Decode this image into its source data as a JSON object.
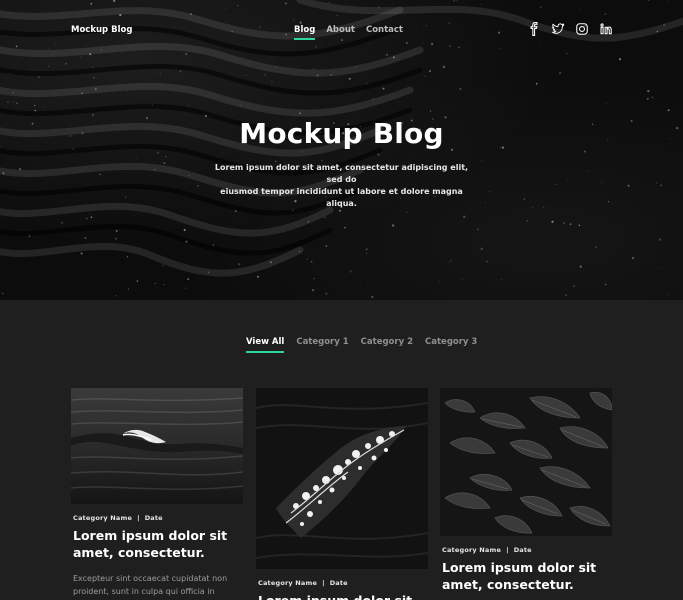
{
  "nav": {
    "brand": "Mockup Blog",
    "links": [
      "Blog",
      "About",
      "Contact"
    ],
    "active_link": "Blog",
    "socials": [
      "facebook-icon",
      "twitter-icon",
      "instagram-icon",
      "linkedin-icon"
    ]
  },
  "hero": {
    "title": "Mockup Blog",
    "subtitle_line1": "Lorem ipsum dolor sit amet, consectetur adipiscing elit, sed do",
    "subtitle_line2": "eiusmod tempor incididunt ut labore et dolore magna aliqua."
  },
  "filters": {
    "tabs": [
      "View All",
      "Category 1",
      "Category 2",
      "Category 3"
    ],
    "active": "View All"
  },
  "posts": [
    {
      "category": "Category Name",
      "date": "Date",
      "title": "Lorem ipsum dolor sit amet, consectetur.",
      "excerpt_line1": "Excepteur sint occaecat cupidatat non",
      "excerpt_line2": "proident, sunt in culpa qui officia in",
      "image": "ocean-wave-photo"
    },
    {
      "category": "Category Name",
      "date": "Date",
      "title": "Lorem ipsum dolor sit",
      "image": "water-splash-photo"
    },
    {
      "category": "Category Name",
      "date": "Date",
      "title": "Lorem ipsum dolor sit amet, consectetur.",
      "image": "dark-leaves-photo"
    }
  ],
  "colors": {
    "accent": "#2bd6a0",
    "page_background": "#1f1f1f",
    "hero_background": "#0c0c0c"
  }
}
